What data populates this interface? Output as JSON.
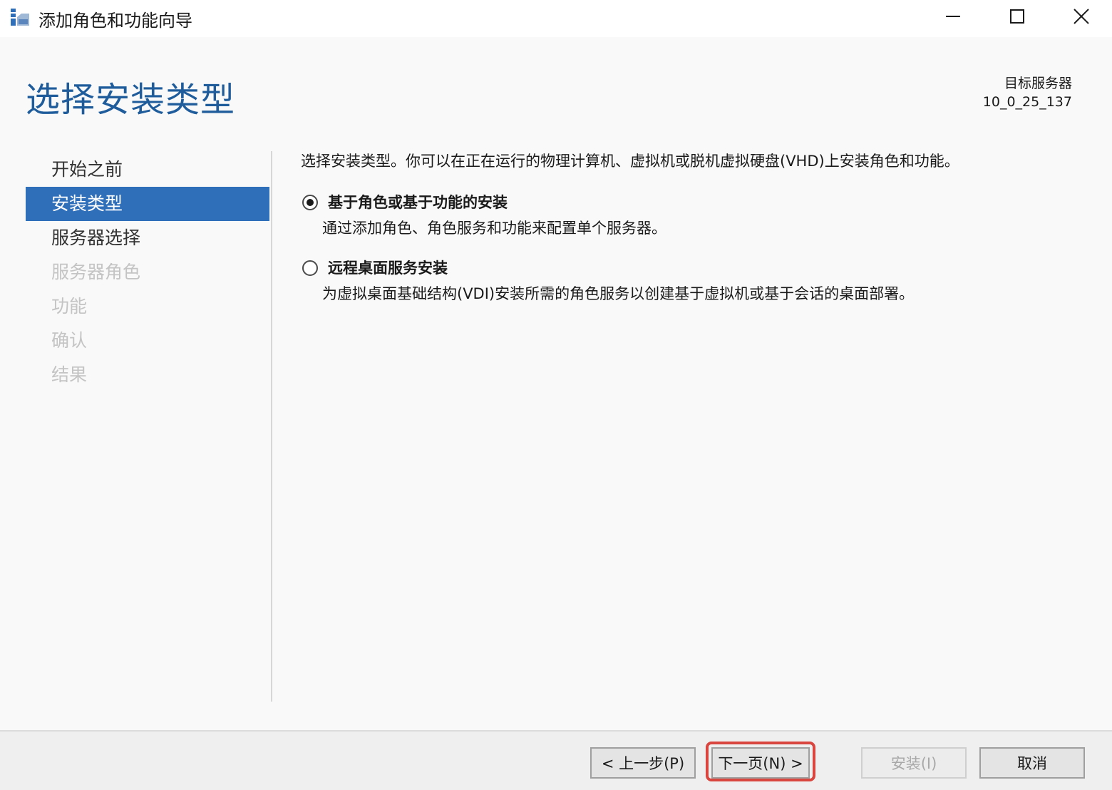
{
  "window": {
    "title": "添加角色和功能向导"
  },
  "header": {
    "page_title": "选择安装类型",
    "target_server_label": "目标服务器",
    "target_server_name": "10_0_25_137"
  },
  "nav": {
    "items": [
      {
        "label": "开始之前",
        "state": "normal"
      },
      {
        "label": "安装类型",
        "state": "active"
      },
      {
        "label": "服务器选择",
        "state": "normal"
      },
      {
        "label": "服务器角色",
        "state": "disabled"
      },
      {
        "label": "功能",
        "state": "disabled"
      },
      {
        "label": "确认",
        "state": "disabled"
      },
      {
        "label": "结果",
        "state": "disabled"
      }
    ]
  },
  "content": {
    "intro": "选择安装类型。你可以在正在运行的物理计算机、虚拟机或脱机虚拟硬盘(VHD)上安装角色和功能。",
    "options": [
      {
        "label": "基于角色或基于功能的安装",
        "description": "通过添加角色、角色服务和功能来配置单个服务器。",
        "selected": true
      },
      {
        "label": "远程桌面服务安装",
        "description": "为虚拟桌面基础结构(VDI)安装所需的角色服务以创建基于虚拟机或基于会话的桌面部署。",
        "selected": false
      }
    ]
  },
  "footer": {
    "prev_label": "< 上一步(P)",
    "next_label": "下一页(N) >",
    "install_label": "安装(I)",
    "cancel_label": "取消"
  },
  "colors": {
    "accent": "#2f6fba",
    "title_blue": "#1e5c9c",
    "highlight": "#d9453f"
  }
}
